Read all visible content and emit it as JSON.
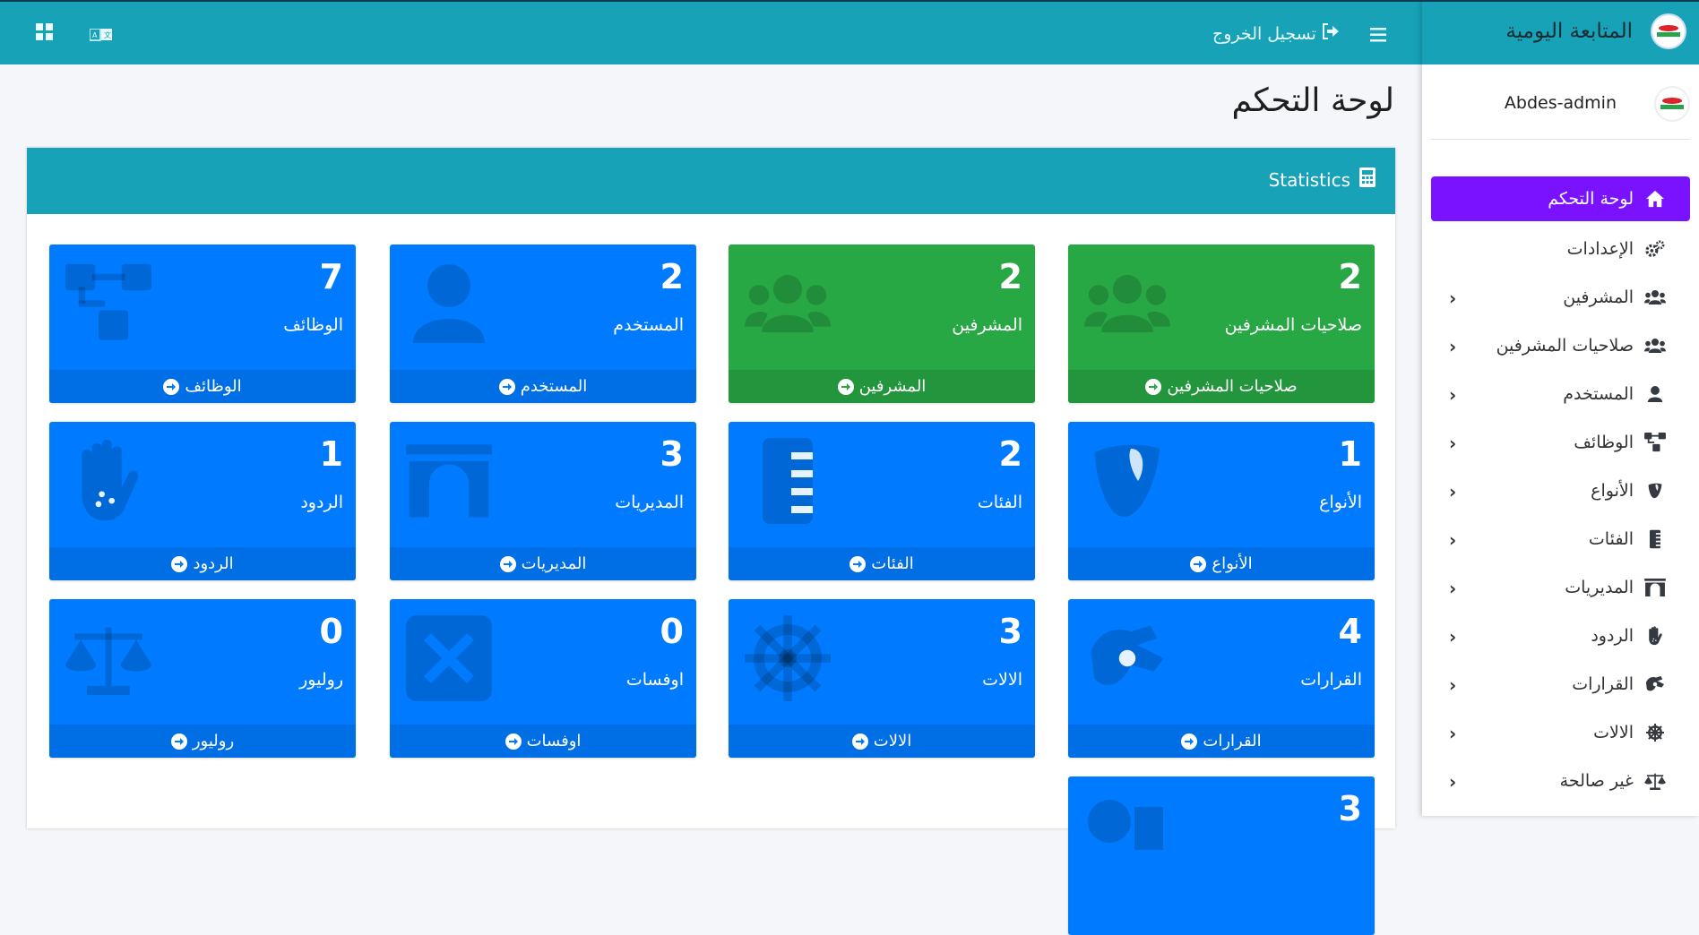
{
  "topbar": {
    "logout_label": "تسجيل الخروج",
    "icons": [
      "grid-icon",
      "translate-icon",
      "hamburger-icon",
      "logout-icon"
    ]
  },
  "sidebar": {
    "brand": "المتابعة اليومية",
    "user": "Abdes-admin",
    "items": [
      {
        "label": "لوحة التحكم",
        "icon": "home-icon",
        "active": true,
        "chevron": false
      },
      {
        "label": "الإعدادات",
        "icon": "gears-icon",
        "active": false,
        "chevron": false
      },
      {
        "label": "المشرفين",
        "icon": "users-icon",
        "active": false,
        "chevron": true
      },
      {
        "label": "صلاحيات المشرفين",
        "icon": "users-icon",
        "active": false,
        "chevron": true
      },
      {
        "label": "المستخدم",
        "icon": "user-icon",
        "active": false,
        "chevron": true
      },
      {
        "label": "الوظائف",
        "icon": "sitemap-icon",
        "active": false,
        "chevron": true
      },
      {
        "label": "الأنواع",
        "icon": "typo3-icon",
        "active": false,
        "chevron": true
      },
      {
        "label": "الفئات",
        "icon": "ruler-icon",
        "active": false,
        "chevron": true
      },
      {
        "label": "المديريات",
        "icon": "archway-icon",
        "active": false,
        "chevron": true
      },
      {
        "label": "الردود",
        "icon": "hand-icon",
        "active": false,
        "chevron": true
      },
      {
        "label": "القرارات",
        "icon": "sign-language-icon",
        "active": false,
        "chevron": true
      },
      {
        "label": "الالات",
        "icon": "dharmachakra-icon",
        "active": false,
        "chevron": true
      },
      {
        "label": "غير صالحة",
        "icon": "balance-scale-icon",
        "active": false,
        "chevron": true
      }
    ]
  },
  "main": {
    "page_title": "لوحة التحكم",
    "card_title": "Statistics",
    "stats": [
      {
        "value": "2",
        "label": "صلاحيات المشرفين",
        "link": "صلاحيات المشرفين",
        "color": "#28a745",
        "icon": "users-icon"
      },
      {
        "value": "2",
        "label": "المشرفين",
        "link": "المشرفين",
        "color": "#28a745",
        "icon": "users-icon"
      },
      {
        "value": "2",
        "label": "المستخدم",
        "link": "المستخدم",
        "color": "#007bff",
        "icon": "user-icon"
      },
      {
        "value": "7",
        "label": "الوظائف",
        "link": "الوظائف",
        "color": "#007bff",
        "icon": "sitemap-icon"
      },
      {
        "value": "1",
        "label": "الأنواع",
        "link": "الأنواع",
        "color": "#007bff",
        "icon": "typo3-icon"
      },
      {
        "value": "2",
        "label": "الفئات",
        "link": "الفئات",
        "color": "#007bff",
        "icon": "ruler-icon"
      },
      {
        "value": "3",
        "label": "المديريات",
        "link": "المديريات",
        "color": "#007bff",
        "icon": "archway-icon"
      },
      {
        "value": "1",
        "label": "الردود",
        "link": "الردود",
        "color": "#007bff",
        "icon": "hand-icon"
      },
      {
        "value": "4",
        "label": "القرارات",
        "link": "القرارات",
        "color": "#007bff",
        "icon": "sign-language-icon"
      },
      {
        "value": "3",
        "label": "الالات",
        "link": "الالات",
        "color": "#007bff",
        "icon": "dharmachakra-icon"
      },
      {
        "value": "0",
        "label": "اوفسات",
        "link": "اوفسات",
        "color": "#007bff",
        "icon": "times-square-icon"
      },
      {
        "value": "0",
        "label": "روليور",
        "link": "روليور",
        "color": "#007bff",
        "icon": "balance-scale-icon"
      },
      {
        "value": "3",
        "label": "",
        "link": "",
        "color": "#007bff",
        "icon": "partial-icon"
      }
    ]
  },
  "colors": {
    "topbar": "#17a2b8",
    "active": "#7a12ff",
    "primary": "#007bff",
    "success": "#28a745"
  }
}
